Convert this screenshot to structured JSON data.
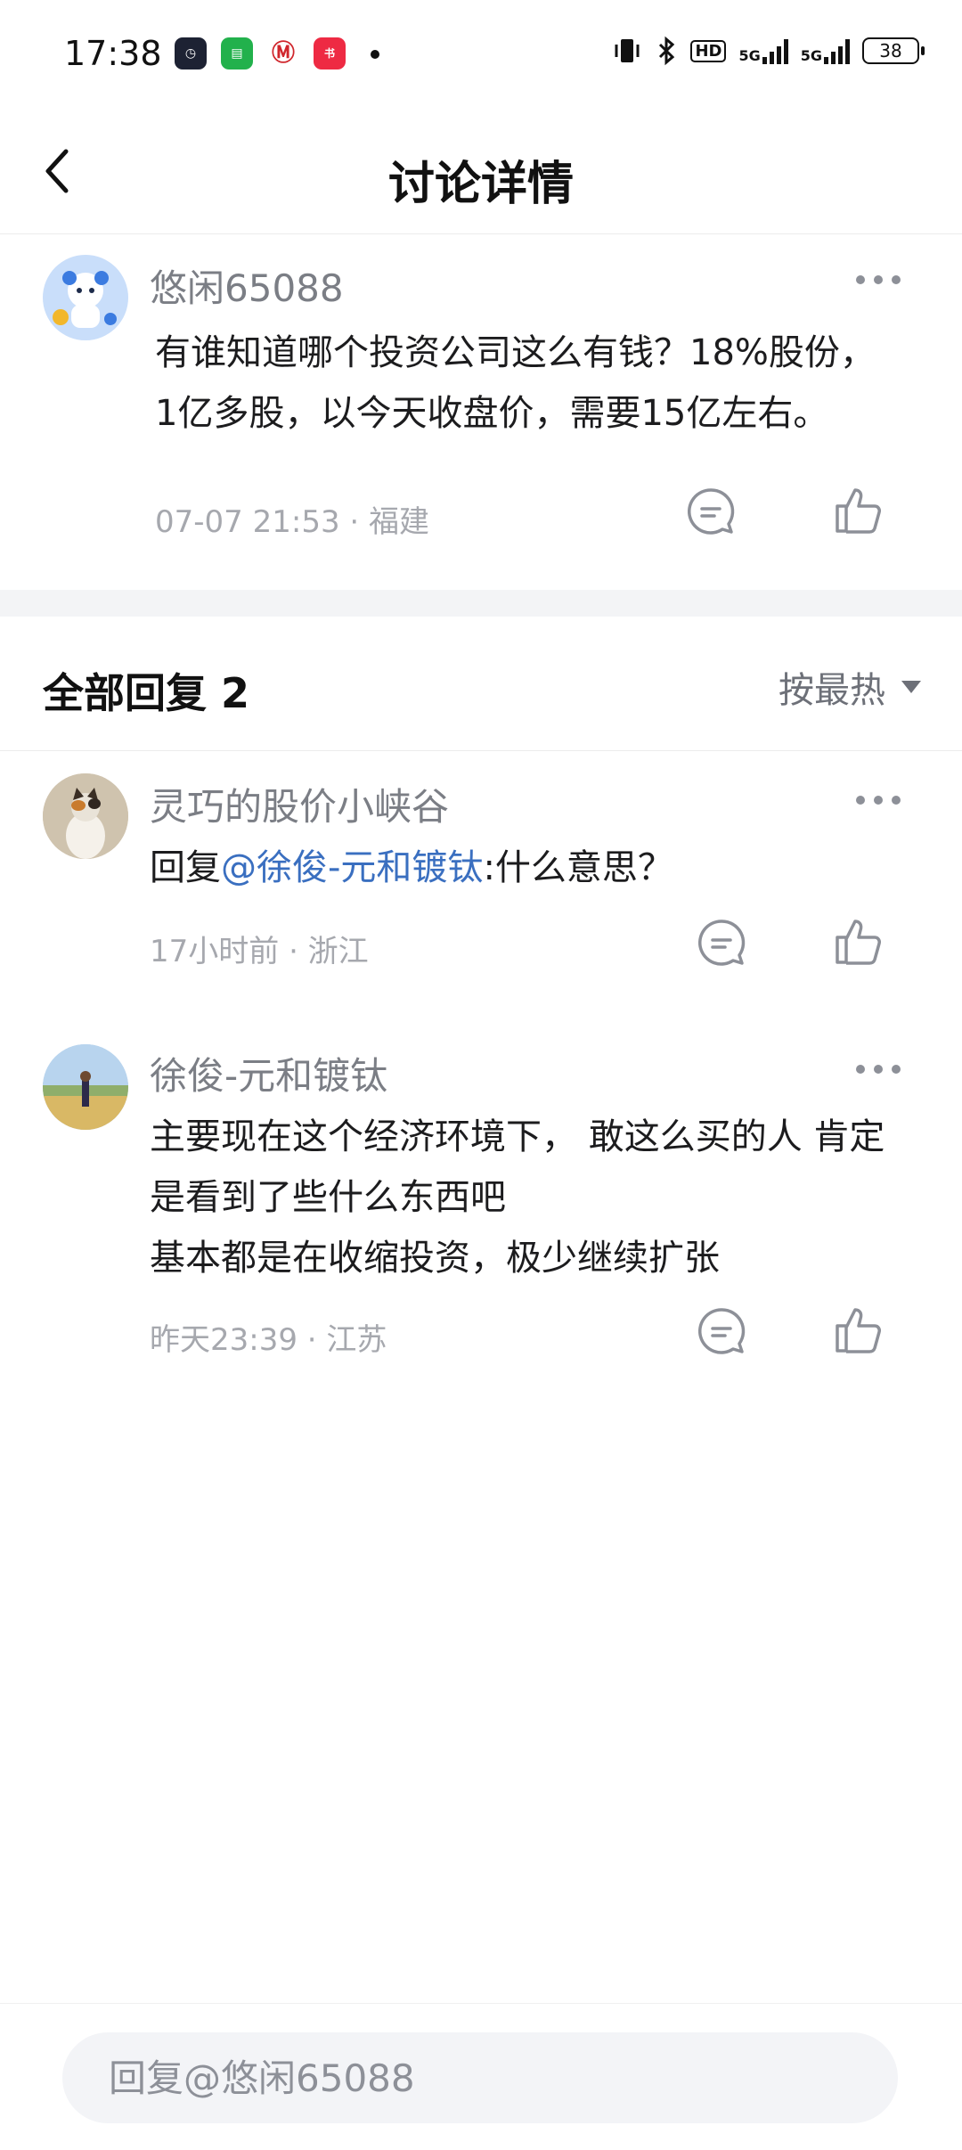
{
  "status_bar": {
    "time": "17:38",
    "hd_label": "HD",
    "net1": "5G",
    "net2": "5G",
    "battery": "38"
  },
  "nav": {
    "title": "讨论详情"
  },
  "post": {
    "username": "悠闲65088",
    "text_line1": "有谁知道哪个投资公司这么有钱？18%股份，",
    "text_line2": "1亿多股，以今天收盘价，需要15亿左右。",
    "meta": "07-07 21:53 · 福建"
  },
  "replies_header": {
    "title": "全部回复 2",
    "sort_label": "按最热"
  },
  "replies": [
    {
      "username": "灵巧的股价小峡谷",
      "prefix": "回复",
      "mention": "@徐俊-元和镀钛",
      "text": ":什么意思？",
      "meta": "17小时前 · 浙江"
    },
    {
      "username": "徐俊-元和镀钛",
      "line1": "主要现在这个经济环境下， 敢这么买的人 肯定",
      "line2": "是看到了些什么东西吧",
      "line3": "基本都是在收缩投资，极少继续扩张",
      "meta": "昨天23:39 · 江苏"
    }
  ],
  "bottom": {
    "placeholder": "回复@悠闲65088"
  },
  "colors": {
    "mention": "#3a6fc0",
    "meta": "#a6a8ae",
    "username": "#7b7e85"
  }
}
